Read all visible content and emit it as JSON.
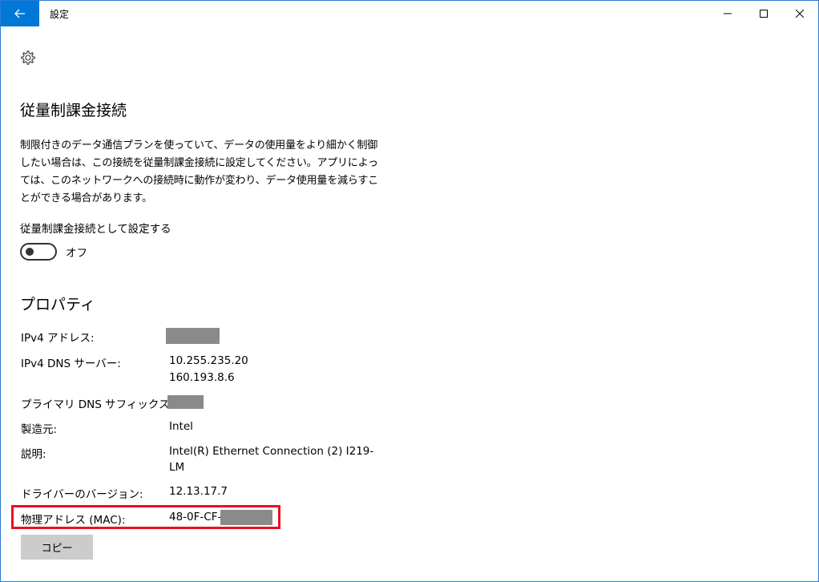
{
  "window": {
    "title": "設定"
  },
  "page": {
    "heading": "従量制課金接続",
    "description": "制限付きのデータ通信プランを使っていて、データの使用量をより細かく制御したい場合は、この接続を従量制課金接続に設定してください。アプリによっては、このネットワークへの接続時に動作が変わり、データ使用量を減らすことができる場合があります。",
    "toggle_label": "従量制課金接続として設定する",
    "toggle_state": "オフ",
    "toggle_on": false
  },
  "properties": {
    "heading": "プロパティ",
    "ipv4_label": "IPv4 アドレス:",
    "dns_label": "IPv4 DNS サーバー:",
    "dns_value_1": "10.255.235.20",
    "dns_value_2": "160.193.8.6",
    "suffix_label": "プライマリ DNS サフィックス:",
    "manufacturer_label": "製造元:",
    "manufacturer_value": "Intel",
    "description_label": "説明:",
    "description_value_1": "Intel(R) Ethernet Connection (2) I219-",
    "description_value_2": "LM",
    "driver_label": "ドライバーのバージョン:",
    "driver_value": "12.13.17.7",
    "mac_label": "物理アドレス (MAC):",
    "mac_value_prefix": "48-0F-CF-",
    "copy_button": "コピー"
  },
  "colors": {
    "accent": "#0078d7",
    "highlight": "#e81123",
    "redaction": "#8a8a8a",
    "button": "#cccccc"
  },
  "icons": {
    "back": "back-arrow-icon",
    "settings": "gear-icon",
    "minimize": "minimize-icon",
    "maximize": "maximize-icon",
    "close": "close-icon"
  }
}
